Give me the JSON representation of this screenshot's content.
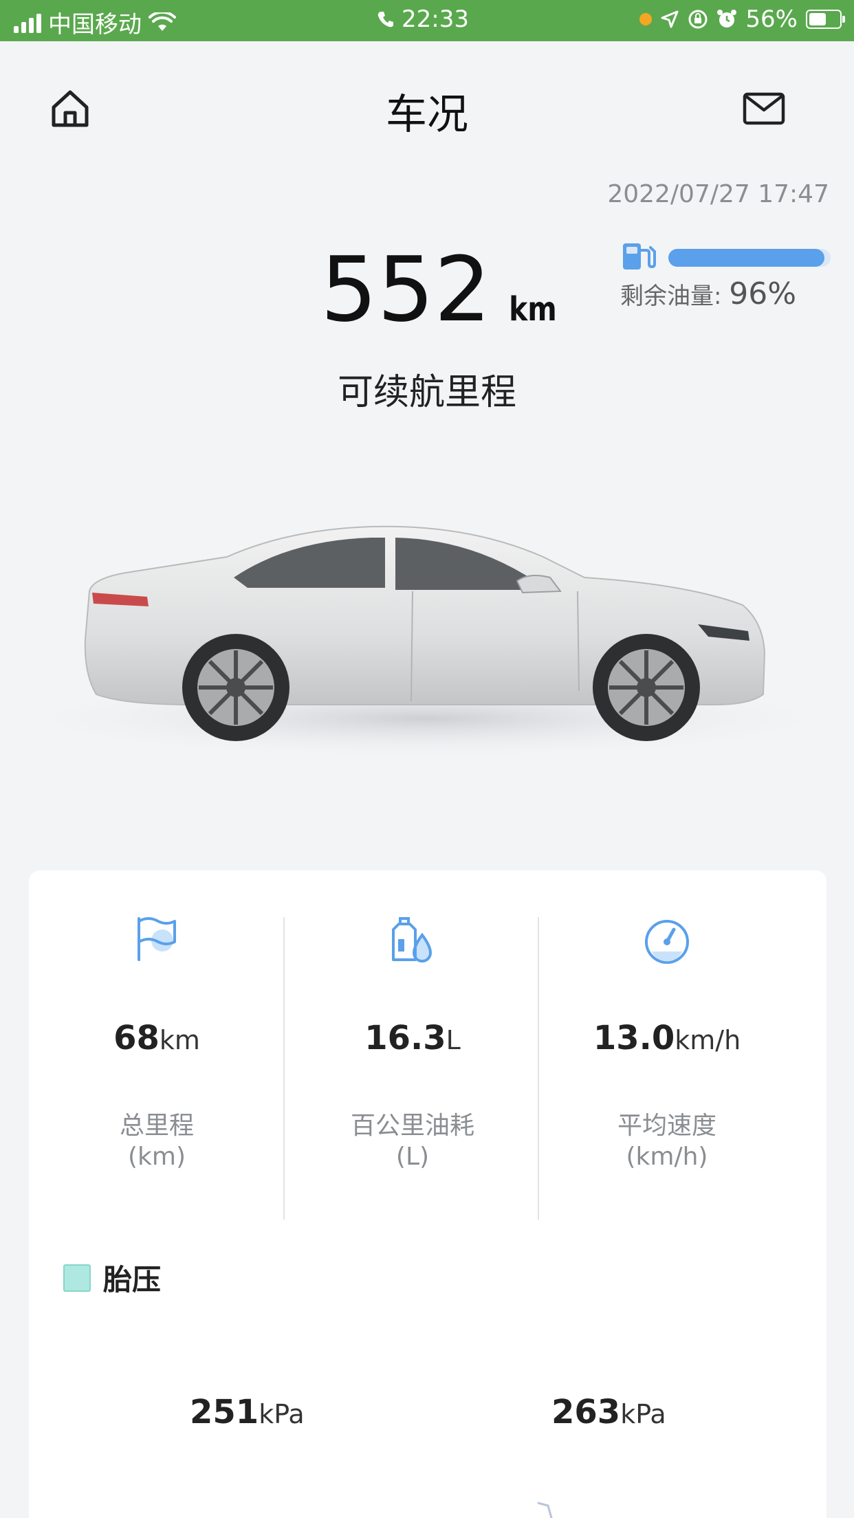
{
  "status_bar": {
    "carrier": "中国移动",
    "time": "22:33",
    "battery": "56%",
    "battery_level": 0.56,
    "icons": [
      "signal-icon",
      "wifi-icon",
      "phone-icon",
      "location-icon",
      "lock-rotation-icon",
      "alarm-icon",
      "battery-icon"
    ]
  },
  "header": {
    "title": "车况",
    "left_icon": "home-icon",
    "right_icon": "mail-icon"
  },
  "timestamp": "2022/07/27 17:47",
  "range": {
    "value": "552",
    "unit": "km",
    "label": "可续航里程"
  },
  "fuel": {
    "label": "剩余油量:",
    "value": "96%",
    "level": 0.96,
    "icon": "fuel-pump-icon"
  },
  "stats": [
    {
      "icon": "flag-icon",
      "value": "68",
      "unit": "km",
      "name": "总里程",
      "sub": "(km)"
    },
    {
      "icon": "fuel-bottle-icon",
      "value": "16.3",
      "unit": "L",
      "name": "百公里油耗",
      "sub": "(L)"
    },
    {
      "icon": "speedometer-icon",
      "value": "13.0",
      "unit": "km/h",
      "name": "平均速度",
      "sub": "(km/h)"
    }
  ],
  "tire": {
    "title": "胎压",
    "front_left": {
      "value": "251",
      "unit": "kPa"
    },
    "front_right": {
      "value": "263",
      "unit": "kPa"
    }
  },
  "colors": {
    "status_bar": "#5aa84e",
    "accent_blue": "#5aa0ea",
    "tire_teal": "#aee8e0",
    "background": "#f3f4f6"
  }
}
